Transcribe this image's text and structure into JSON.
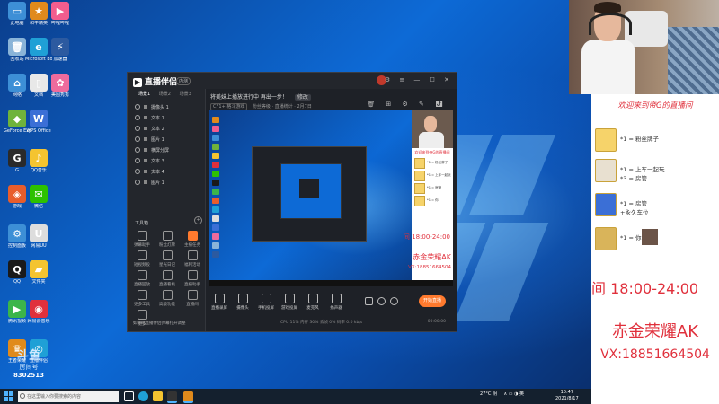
{
  "desktop": {
    "icons": [
      {
        "label": "此电脑",
        "color": "#3d8fd6",
        "glyph": "▭"
      },
      {
        "label": "和平精英",
        "color": "#e08a1c",
        "glyph": "★"
      },
      {
        "label": "哔哩哔哩",
        "color": "#f25d8e",
        "glyph": "▶"
      },
      {
        "label": "回收站",
        "color": "#8ab4d8",
        "glyph": "🗑"
      },
      {
        "label": "Microsoft Edge",
        "color": "#1fa0d6",
        "glyph": "e"
      },
      {
        "label": "加速器",
        "color": "#2c5aa0",
        "glyph": "⚡"
      },
      {
        "label": "网络",
        "color": "#3d8fd6",
        "glyph": "⌂"
      },
      {
        "label": "文档",
        "color": "#e8e8e8",
        "glyph": "▯"
      },
      {
        "label": "美图秀秀",
        "color": "#ee6b9d",
        "glyph": "✿"
      },
      {
        "label": "GeForce Experience",
        "color": "#6fb33b",
        "glyph": "◆"
      },
      {
        "label": "WPS Office",
        "color": "#3b6fd6",
        "glyph": "W"
      },
      {
        "label": "G",
        "color": "#2a2a2a",
        "glyph": "G"
      },
      {
        "label": "QQ音乐",
        "color": "#f4c430",
        "glyph": "♪"
      },
      {
        "label": "游戏",
        "color": "#e85d2c",
        "glyph": "◈"
      },
      {
        "label": "微信",
        "color": "#2dc100",
        "glyph": "✉"
      },
      {
        "label": "控制面板",
        "color": "#3d8fd6",
        "glyph": "⚙"
      },
      {
        "label": "网易UU",
        "color": "#dddddd",
        "glyph": "U"
      },
      {
        "label": "QQ",
        "color": "#1a1a1a",
        "glyph": "Q"
      },
      {
        "label": "文件夹",
        "color": "#f4c430",
        "glyph": "▰"
      },
      {
        "label": "腾讯视频",
        "color": "#3bb54a",
        "glyph": "▶"
      },
      {
        "label": "网易云音乐",
        "color": "#e0303c",
        "glyph": "◉"
      },
      {
        "label": "王者荣耀",
        "color": "#e08a1c",
        "glyph": "♛"
      },
      {
        "label": "直播伴侣",
        "color": "#1fa0d6",
        "glyph": "◎"
      }
    ],
    "watermark": {
      "line1": "斗鱼",
      "line2": "房间号",
      "line3": "8302513"
    }
  },
  "app": {
    "logo_text": "直播伴侣",
    "version_badge": "内测",
    "window_controls": "⚙ ≡ — ☐ ✕",
    "tabs": [
      "场景1",
      "场景2",
      "场景3"
    ],
    "layers": [
      "摄像头 1",
      "文本 1",
      "文本 2",
      "图片 1",
      "横屏分屏",
      "文本 3",
      "文本 4",
      "图片 1"
    ],
    "toolbox_title": "工具箱",
    "tools": [
      "弹幕助手",
      "粉丝灯牌",
      "主播任务",
      "短视频投",
      "星光日记",
      "福利活动",
      "直播回放",
      "直播看板",
      "直播助手",
      "更多工具",
      "高级功能",
      "直播间",
      "更多"
    ],
    "notice": "如何把直播伴侣弹幕打开调整",
    "stream_title": "将美妹上播放进行中 再出一步！",
    "stream_edit": "修改",
    "stream_tag": "CF1+ 格斗游戏",
    "stream_sub": "粉丝等级 · 直播统计 · 2月7日",
    "bottom_buttons": [
      "直播录屏",
      "摄像头",
      "手机投屏",
      "游戏投屏",
      "麦克风",
      "扬声器"
    ],
    "start_live": "开始直播",
    "status_line": "CPU 11%   内存 30%   丢帧 0%   码率 0.0 kb/s",
    "live_timer": "00:00:00"
  },
  "preview": {
    "side_header": "欢迎来到帝G的直播间",
    "time": "间 18:00-24:00",
    "name": "赤金荣耀AK",
    "vx": "VX:18851664504"
  },
  "taskbar": {
    "search_placeholder": "在这里输入你要搜索的内容",
    "weather": "27°C 阴",
    "tray_icons": "∧ ▭ ◑ 英",
    "time": "10:47",
    "date": "2021/8/17"
  },
  "overlay": {
    "welcome": "欢迎来到帝G的直播间",
    "rows": [
      {
        "t1": "*1 = 粉丝牌子",
        "t2": ""
      },
      {
        "t1": "*1 = 上车一起玩",
        "t2": "*3 = 房管"
      },
      {
        "t1": "*1 = 房管",
        "t2": "+永久车位"
      },
      {
        "t1": "*1 = 你",
        "t2": ""
      }
    ],
    "time": "间 18:00-24:00",
    "name": "赤金荣耀AK",
    "vx": "VX:18851664504"
  },
  "colors": {
    "accent": "#ff7a2e",
    "overlay_red": "#e0303c",
    "app_bg": "#1e2127"
  }
}
